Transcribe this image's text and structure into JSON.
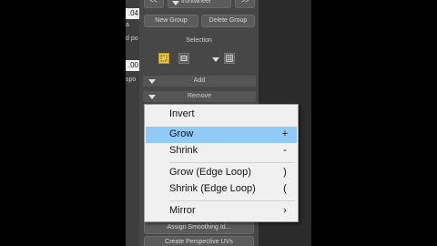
{
  "top": {
    "prev_label": "<<",
    "object_name": "frontwheel",
    "next_label": ">>"
  },
  "group_buttons": {
    "new_group": "New Group",
    "delete_group": "Delete Group"
  },
  "selection": {
    "label": "Selection",
    "add": "Add",
    "remove": "Remove"
  },
  "left_strip": {
    "field1": ".04",
    "text1": "a",
    "text2": "d po",
    "field2": ".00",
    "text3": "spo"
  },
  "bottom_buttons": {
    "assign_smoothing": "Assign Smoothing Id...",
    "create_perspective": "Create Perspective UVs"
  },
  "context_menu": {
    "items": [
      {
        "label": "Invert",
        "shortcut": ""
      },
      {
        "label": "Grow",
        "shortcut": "+"
      },
      {
        "label": "Shrink",
        "shortcut": "-"
      },
      {
        "label": "Grow (Edge Loop)",
        "shortcut": ")"
      },
      {
        "label": "Shrink (Edge Loop)",
        "shortcut": "("
      },
      {
        "label": "Mirror",
        "shortcut": ""
      }
    ],
    "highlighted": "Grow",
    "submenu_arrow": "›"
  },
  "colors": {
    "menu_highlight": "#91c9f7",
    "selected_tool_icon": "#e8c84a"
  }
}
